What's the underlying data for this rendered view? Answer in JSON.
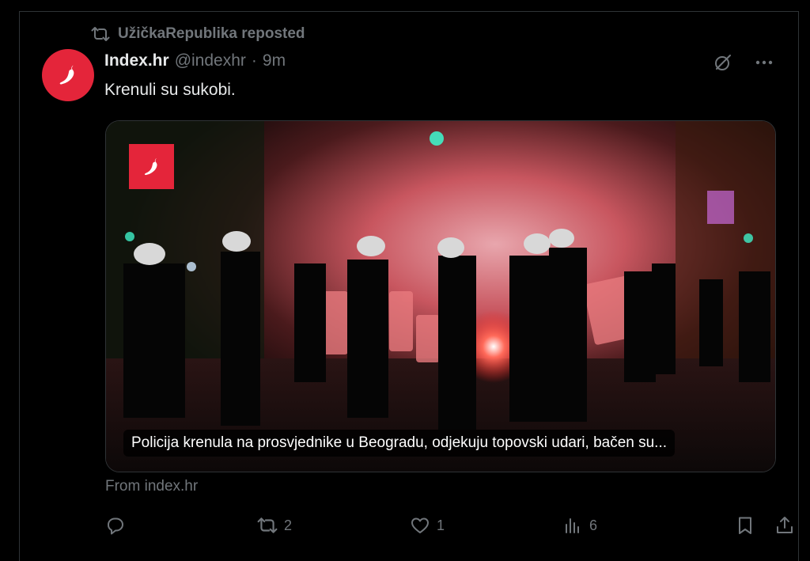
{
  "repost": {
    "text": "UžičkaRepublika reposted"
  },
  "author": {
    "name": "Index.hr",
    "handle": "@indexhr",
    "separator": "·",
    "time": "9m"
  },
  "tweet": {
    "text": "Krenuli su sukobi."
  },
  "card": {
    "caption": "Policija krenula na prosvjednike u Beogradu, odjekuju topovski udari, bačen su...",
    "source": "From index.hr"
  },
  "actions": {
    "reply_count": "",
    "repost_count": "2",
    "like_count": "1",
    "views_count": "6"
  },
  "colors": {
    "brand_red": "#e4253a",
    "muted": "#71767b",
    "text": "#e7e9ea",
    "border": "#2f3336",
    "background": "#000000"
  },
  "icons": [
    "repost-icon",
    "grok-icon",
    "more-icon",
    "reply-icon",
    "like-icon",
    "views-icon",
    "bookmark-icon",
    "share-icon",
    "chili-logo-icon"
  ]
}
